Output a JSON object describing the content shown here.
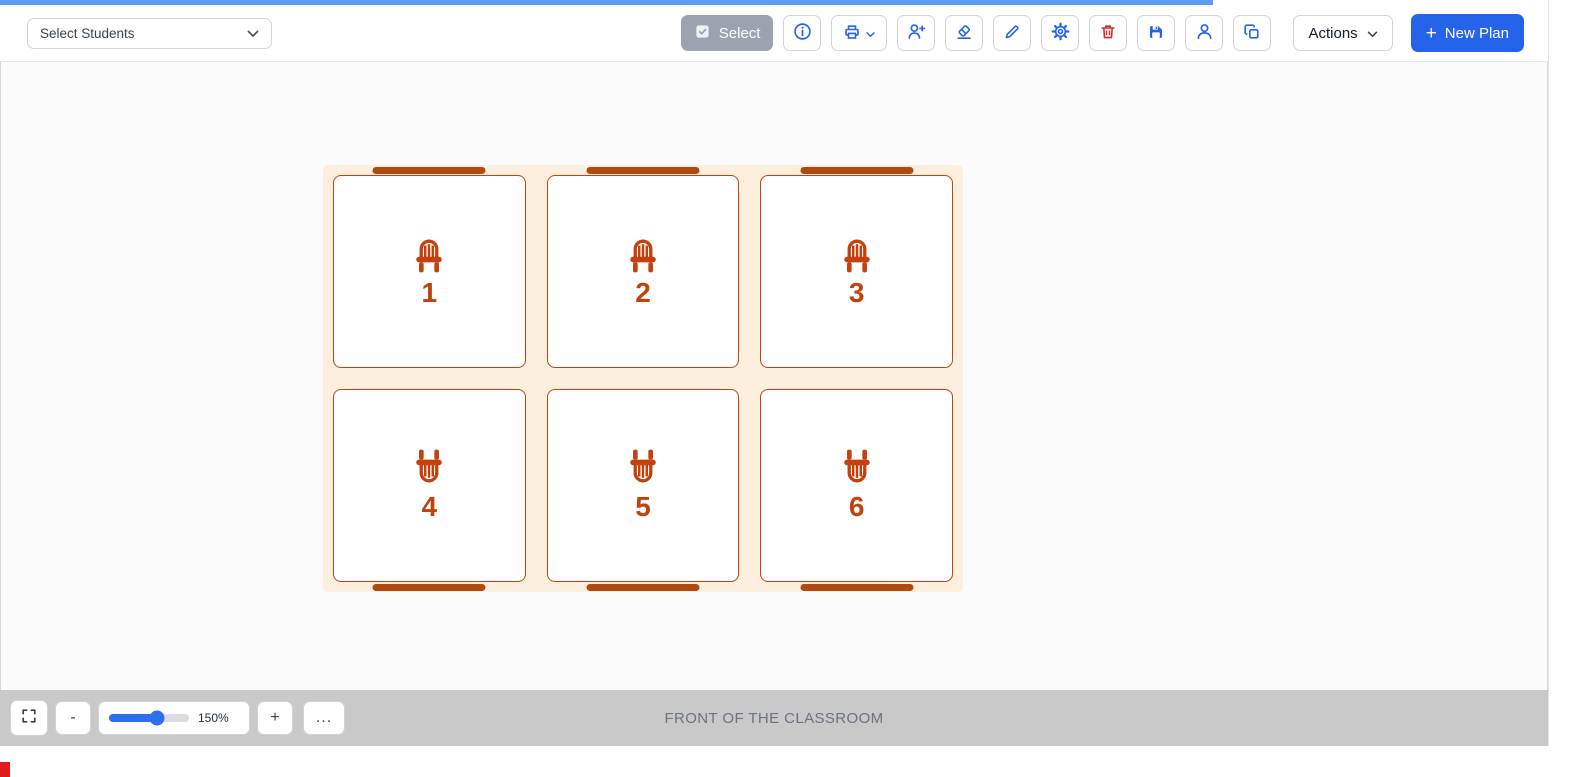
{
  "topbar": {
    "student_select": {
      "value": "Select Students"
    },
    "select_button": {
      "label": "Select"
    },
    "actions_button": {
      "label": "Actions"
    },
    "new_plan_button": {
      "plus": "+",
      "label": "New Plan"
    },
    "toolbar_icons": [
      "select-checkbox",
      "info",
      "printer",
      "person-add",
      "eraser",
      "pencil",
      "gear",
      "trash",
      "save",
      "person",
      "copy"
    ]
  },
  "seating": {
    "seats": [
      {
        "number": "1",
        "row": "front"
      },
      {
        "number": "2",
        "row": "front"
      },
      {
        "number": "3",
        "row": "front"
      },
      {
        "number": "4",
        "row": "back"
      },
      {
        "number": "5",
        "row": "back"
      },
      {
        "number": "6",
        "row": "back"
      }
    ]
  },
  "statusbar": {
    "zoom_out_label": "-",
    "zoom_in_label": "+",
    "zoom_level": "150%",
    "more_label": "...",
    "front_label": "FRONT OF THE CLASSROOM"
  },
  "colors": {
    "accent_blue": "#2563eb",
    "seat_orange": "#c2410c",
    "seat_bar_orange": "#b04a10",
    "seat_area_bg": "#fcefdd",
    "danger_red": "#dc2626",
    "statusbar_gray": "#c9c9c9",
    "progress_blue": "#5b9cf6"
  }
}
